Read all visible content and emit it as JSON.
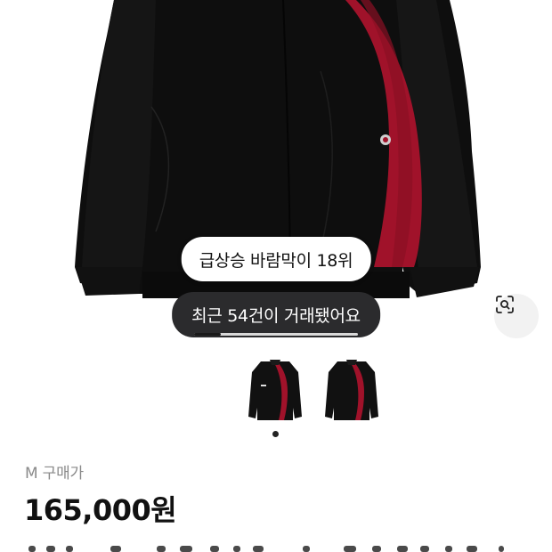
{
  "product": {
    "popularity_badge": "급상승 바람막이 18위",
    "trade_count_badge": "최근 54건이 거래됐어요",
    "size_purchase_label": "M 구매가",
    "price": "165,000원"
  },
  "gallery": {
    "image_count": 2,
    "selected_index": 0
  },
  "icons": {
    "lens": "image-search-icon"
  },
  "colors": {
    "jacket_body": "#0d0d0d",
    "jacket_accent": "#a0122a",
    "badge_dark": "#2b2b2d"
  }
}
